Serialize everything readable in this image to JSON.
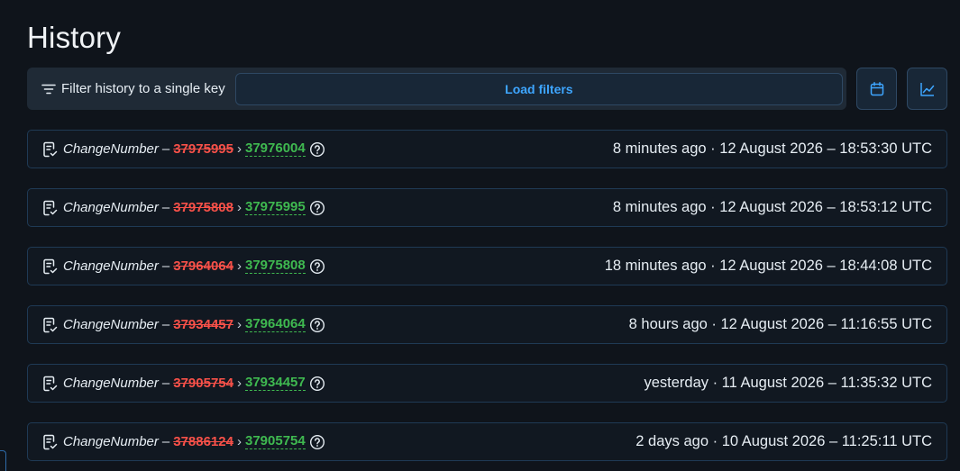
{
  "page": {
    "title": "History"
  },
  "toolbar": {
    "filter_label": "Filter history to a single key",
    "load_button": "Load filters",
    "calendar_icon": "calendar-icon",
    "chart_icon": "line-chart-icon"
  },
  "colors": {
    "background": "#0f141b",
    "old_value": "#f85149",
    "new_value": "#3fb950",
    "accent": "#3ea6ff"
  },
  "history": [
    {
      "key": "ChangeNumber",
      "old": "37975995",
      "new": "37976004",
      "time": "8 minutes ago · 12 August 2026 – 18:53:30 UTC"
    },
    {
      "key": "ChangeNumber",
      "old": "37975808",
      "new": "37975995",
      "time": "8 minutes ago · 12 August 2026 – 18:53:12 UTC"
    },
    {
      "key": "ChangeNumber",
      "old": "37964064",
      "new": "37975808",
      "time": "18 minutes ago · 12 August 2026 – 18:44:08 UTC"
    },
    {
      "key": "ChangeNumber",
      "old": "37934457",
      "new": "37964064",
      "time": "8 hours ago · 12 August 2026 – 11:16:55 UTC"
    },
    {
      "key": "ChangeNumber",
      "old": "37905754",
      "new": "37934457",
      "time": "yesterday · 11 August 2026 – 11:35:32 UTC"
    },
    {
      "key": "ChangeNumber",
      "old": "37886124",
      "new": "37905754",
      "time": "2 days ago · 10 August 2026 – 11:25:11 UTC"
    }
  ],
  "row_separators": {
    "dash": "–",
    "arrow": "›"
  }
}
